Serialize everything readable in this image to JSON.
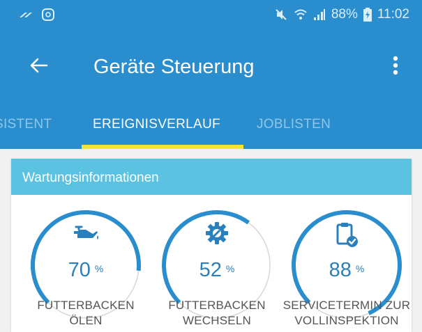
{
  "status_bar": {
    "battery": "88%",
    "time": "11:02",
    "icons": [
      "link-icon",
      "notification-icon",
      "mute-icon",
      "wifi-icon",
      "signal-icon",
      "battery-icon"
    ]
  },
  "app_bar": {
    "title": "Geräte Steuerung",
    "back_icon": "arrow-left-icon",
    "menu_icon": "more-vert-icon"
  },
  "tabs": [
    {
      "label": "SISTENT",
      "active": false
    },
    {
      "label": "EREIGNISVERLAUF",
      "active": true
    },
    {
      "label": "JOBLISTEN",
      "active": false
    }
  ],
  "card": {
    "header": "Wartungsinformationen",
    "gauges": [
      {
        "icon": "oil-can-icon",
        "value": 70,
        "value_text": "70",
        "unit": "%",
        "label_line1": "FUTTERBACKEN",
        "label_line2": "ÖLEN"
      },
      {
        "icon": "gear-wrench-icon",
        "value": 52,
        "value_text": "52",
        "unit": "%",
        "label_line1": "FUTTERBACKEN",
        "label_line2": "WECHSELN"
      },
      {
        "icon": "clipboard-check-icon",
        "value": 88,
        "value_text": "88",
        "unit": "%",
        "label_line1": "SERVICETERMIN ZUR",
        "label_line2": "VOLLINSPEKTION"
      }
    ]
  },
  "colors": {
    "primary": "#2a8dcd",
    "card_header": "#5cc2e2",
    "tab_indicator": "#f3e23c",
    "gauge_progress": "#2a8dcd",
    "gauge_track": "#d6d6d6"
  }
}
